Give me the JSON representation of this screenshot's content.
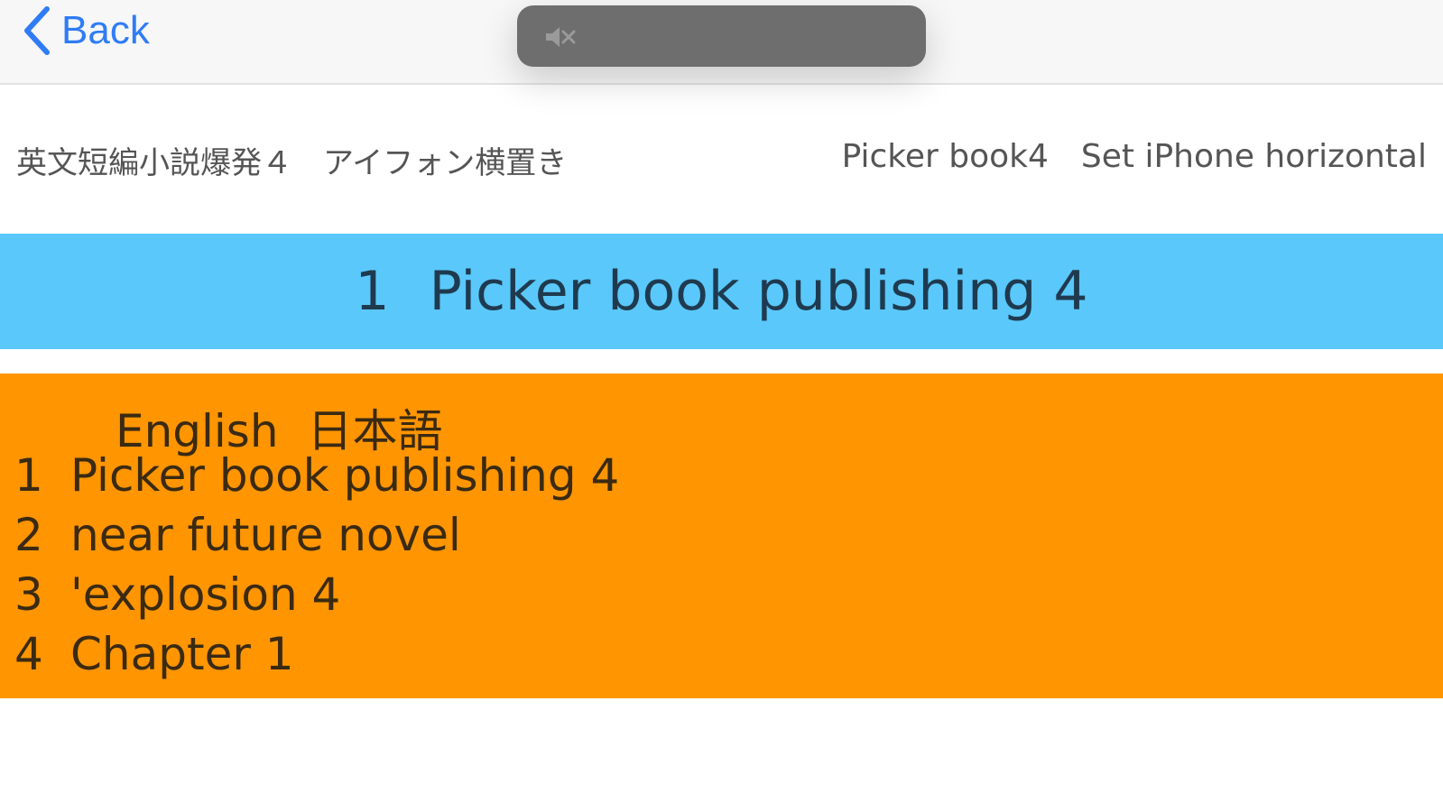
{
  "navbar": {
    "back_label": "Back"
  },
  "info": {
    "left_text": "英文短編小説爆発４　アイフォン横置き",
    "right_title": "Picker book4",
    "right_hint": "Set iPhone horizontal"
  },
  "selected_row": {
    "number": "1",
    "title": "Picker book publishing 4"
  },
  "panel": {
    "header_english": "English",
    "header_japanese": "日本語",
    "items": [
      {
        "number": "1",
        "text": "Picker book publishing 4"
      },
      {
        "number": "2",
        "text": "near future novel"
      },
      {
        "number": "3",
        "text": "'explosion 4"
      },
      {
        "number": "4",
        "text": "Chapter 1"
      }
    ]
  },
  "icons": {
    "back": "chevron-left-icon",
    "mute": "speaker-muted-icon"
  },
  "colors": {
    "accent": "#2f7cf6",
    "selected_row_bg": "#5ac8fa",
    "panel_bg": "#ff9500",
    "hud_bg": "#6e6e6e"
  }
}
